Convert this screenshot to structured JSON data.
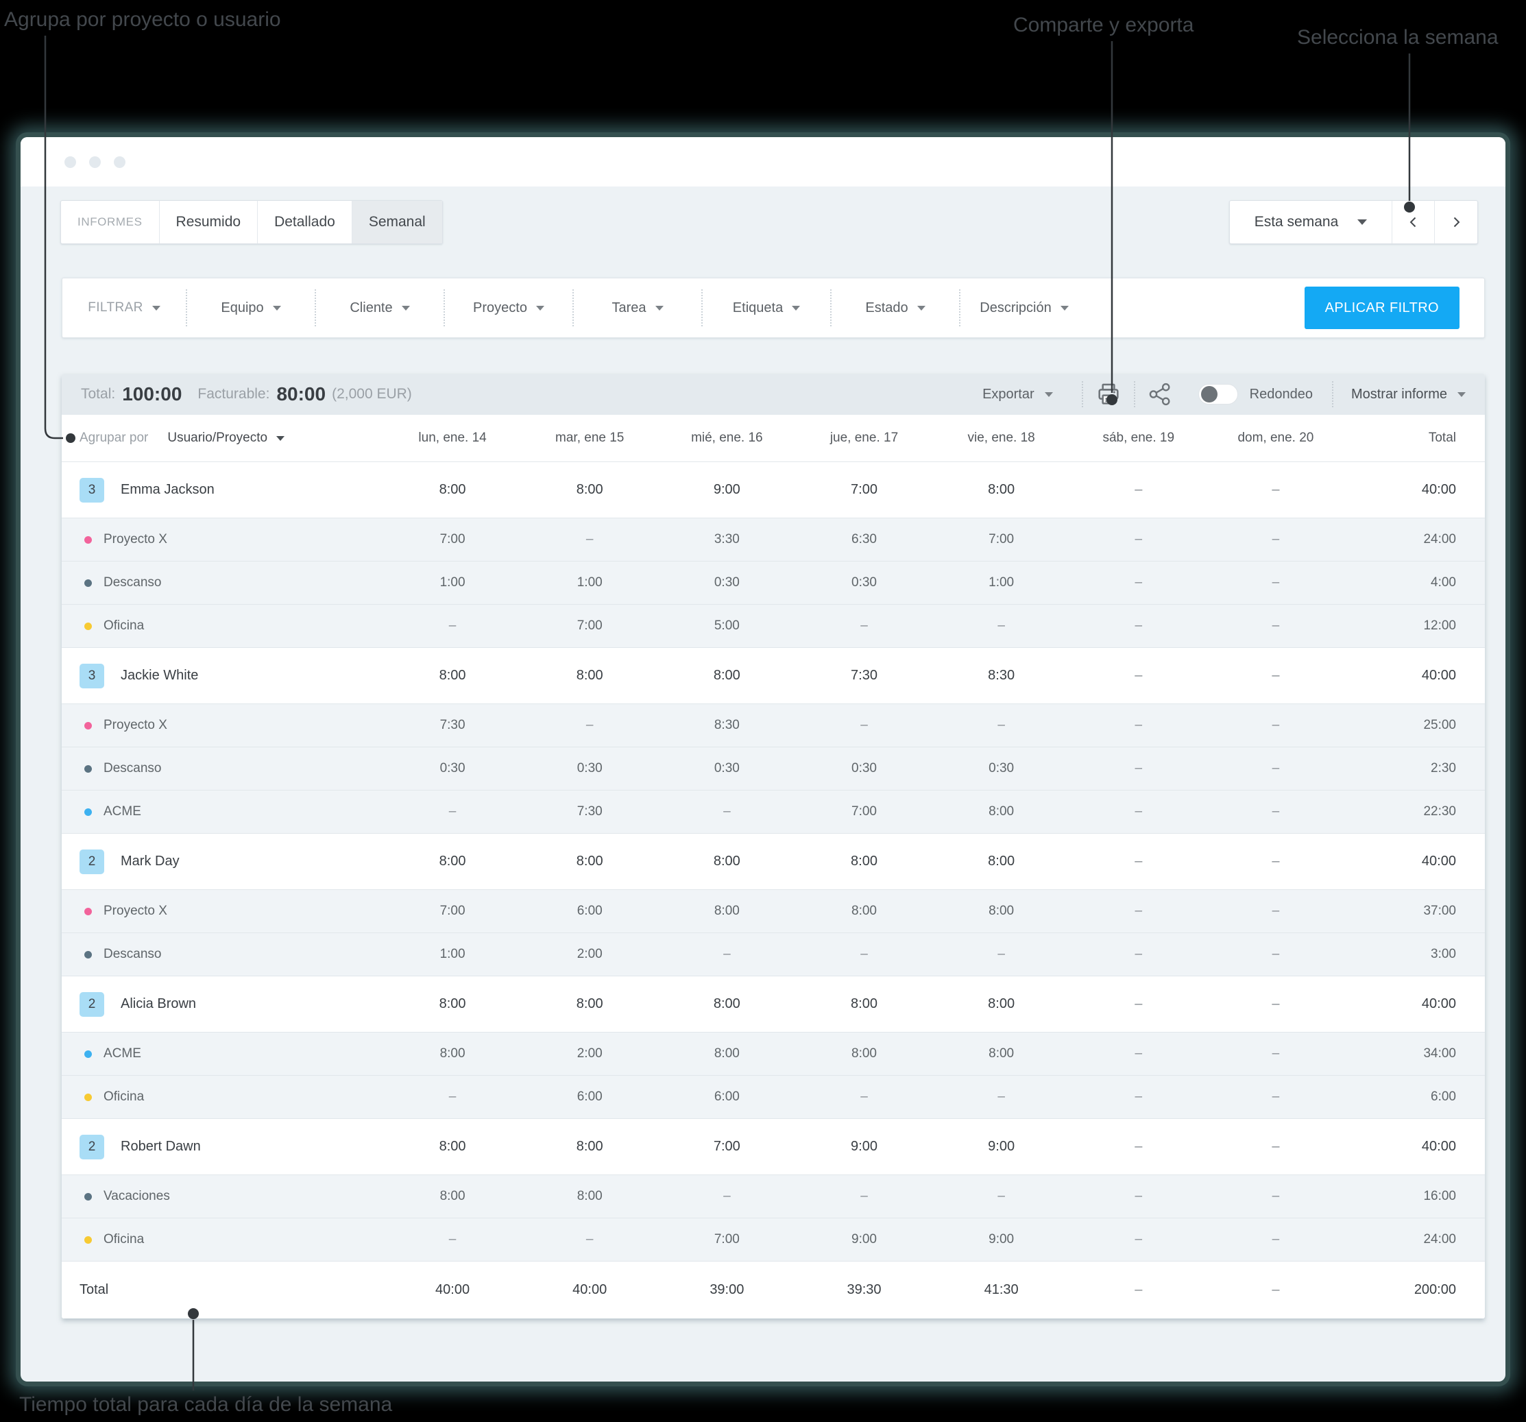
{
  "annotations": {
    "group_by": "Agrupa por proyecto o usuario",
    "share_export": "Comparte y exporta",
    "select_week": "Selecciona la semana",
    "total_time": "Tiempo total para cada día de la semana"
  },
  "tabs": {
    "reports_label": "INFORMES",
    "items": [
      "Resumido",
      "Detallado",
      "Semanal"
    ],
    "active": "Semanal"
  },
  "week_selector": {
    "label": "Esta semana"
  },
  "filters": {
    "filter_label": "FILTRAR",
    "items": [
      "Equipo",
      "Cliente",
      "Proyecto",
      "Tarea",
      "Etiqueta",
      "Estado",
      "Descripción"
    ],
    "apply_label": "APLICAR FILTRO"
  },
  "summary": {
    "total_label": "Total:",
    "total_value": "100:00",
    "billable_label": "Facturable:",
    "billable_value": "80:00",
    "billable_amount": "(2,000 EUR)",
    "export_label": "Exportar",
    "rounding_label": "Redondeo",
    "rounding_state": "off",
    "show_report_label": "Mostrar informe"
  },
  "table": {
    "group_by_label": "Agrupar por",
    "group_by_value": "Usuario/Proyecto",
    "columns": [
      "lun, ene. 14",
      "mar, ene 15",
      "mié, ene. 16",
      "jue, ene. 17",
      "vie, ene. 18",
      "sáb, ene. 19",
      "dom, ene. 20",
      "Total"
    ],
    "groups": [
      {
        "badge": "3",
        "name": "Emma Jackson",
        "values": [
          "8:00",
          "8:00",
          "9:00",
          "7:00",
          "8:00",
          "–",
          "–",
          "40:00"
        ],
        "projects": [
          {
            "name": "Proyecto X",
            "color": "#f2639b",
            "values": [
              "7:00",
              "–",
              "3:30",
              "6:30",
              "7:00",
              "–",
              "–",
              "24:00"
            ]
          },
          {
            "name": "Descanso",
            "color": "#5b7382",
            "values": [
              "1:00",
              "1:00",
              "0:30",
              "0:30",
              "1:00",
              "–",
              "–",
              "4:00"
            ]
          },
          {
            "name": "Oficina",
            "color": "#f7ca33",
            "values": [
              "–",
              "7:00",
              "5:00",
              "–",
              "–",
              "–",
              "–",
              "12:00"
            ]
          }
        ]
      },
      {
        "badge": "3",
        "name": "Jackie White",
        "values": [
          "8:00",
          "8:00",
          "8:00",
          "7:30",
          "8:30",
          "–",
          "–",
          "40:00"
        ],
        "projects": [
          {
            "name": "Proyecto X",
            "color": "#f2639b",
            "values": [
              "7:30",
              "–",
              "8:30",
              "–",
              "–",
              "–",
              "–",
              "25:00"
            ]
          },
          {
            "name": "Descanso",
            "color": "#5b7382",
            "values": [
              "0:30",
              "0:30",
              "0:30",
              "0:30",
              "0:30",
              "–",
              "–",
              "2:30"
            ]
          },
          {
            "name": "ACME",
            "color": "#3db1f0",
            "values": [
              "–",
              "7:30",
              "–",
              "7:00",
              "8:00",
              "–",
              "–",
              "22:30"
            ]
          }
        ]
      },
      {
        "badge": "2",
        "name": "Mark Day",
        "values": [
          "8:00",
          "8:00",
          "8:00",
          "8:00",
          "8:00",
          "–",
          "–",
          "40:00"
        ],
        "projects": [
          {
            "name": "Proyecto X",
            "color": "#f2639b",
            "values": [
              "7:00",
              "6:00",
              "8:00",
              "8:00",
              "8:00",
              "–",
              "–",
              "37:00"
            ]
          },
          {
            "name": "Descanso",
            "color": "#5b7382",
            "values": [
              "1:00",
              "2:00",
              "–",
              "–",
              "–",
              "–",
              "–",
              "3:00"
            ]
          }
        ]
      },
      {
        "badge": "2",
        "name": "Alicia Brown",
        "values": [
          "8:00",
          "8:00",
          "8:00",
          "8:00",
          "8:00",
          "–",
          "–",
          "40:00"
        ],
        "projects": [
          {
            "name": "ACME",
            "color": "#3db1f0",
            "values": [
              "8:00",
              "2:00",
              "8:00",
              "8:00",
              "8:00",
              "–",
              "–",
              "34:00"
            ]
          },
          {
            "name": "Oficina",
            "color": "#f7ca33",
            "values": [
              "–",
              "6:00",
              "6:00",
              "–",
              "–",
              "–",
              "–",
              "6:00"
            ]
          }
        ]
      },
      {
        "badge": "2",
        "name": "Robert Dawn",
        "values": [
          "8:00",
          "8:00",
          "7:00",
          "9:00",
          "9:00",
          "–",
          "–",
          "40:00"
        ],
        "projects": [
          {
            "name": "Vacaciones",
            "color": "#5b7382",
            "values": [
              "8:00",
              "8:00",
              "–",
              "–",
              "–",
              "–",
              "–",
              "16:00"
            ]
          },
          {
            "name": "Oficina",
            "color": "#f7ca33",
            "values": [
              "–",
              "–",
              "7:00",
              "9:00",
              "9:00",
              "–",
              "–",
              "24:00"
            ]
          }
        ]
      }
    ],
    "total_row": {
      "label": "Total",
      "values": [
        "40:00",
        "40:00",
        "39:00",
        "39:30",
        "41:30",
        "–",
        "–",
        "200:00"
      ]
    }
  },
  "colors": {
    "accent_blue": "#14a9f4",
    "badge_bg": "#a9ddf6",
    "summary_bar_bg": "#e4eaee",
    "subrow_bg": "#f0f4f7",
    "annotation_text": "#43484d"
  }
}
